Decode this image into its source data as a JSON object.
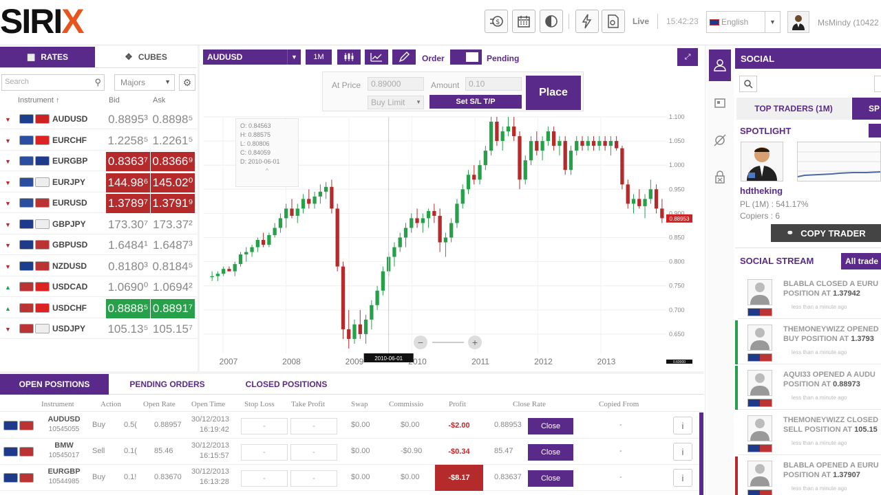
{
  "brand": {
    "logo_main": "SIRI",
    "logo_x": "X"
  },
  "topbar": {
    "live": "Live",
    "time": "15:42:23",
    "language": "English",
    "user": "MsMindy (10422"
  },
  "rates": {
    "tab_rates": "RATES",
    "tab_cubes": "CUBES",
    "search_placeholder": "Search",
    "filter": "Majors",
    "col_instrument": "Instrument ↑",
    "col_bid": "Bid",
    "col_ask": "Ask",
    "rows": [
      {
        "symbol": "AUDUSD",
        "bid": "0.8895³",
        "ask": "0.8898⁵",
        "dir": "down",
        "style": "plain",
        "flag1": "#1a3f8f",
        "flag2": "#c22"
      },
      {
        "symbol": "EURCHF",
        "bid": "1.2258⁵",
        "ask": "1.2261⁵",
        "dir": "down",
        "style": "plain",
        "flag1": "#2a4fa0",
        "flag2": "#d22"
      },
      {
        "symbol": "EURGBP",
        "bid": "0.8363⁷",
        "ask": "0.8366⁹",
        "dir": "down",
        "style": "red",
        "flag1": "#2a4fa0",
        "flag2": "#1d3b8a"
      },
      {
        "symbol": "EURJPY",
        "bid": "144.98⁶",
        "ask": "145.02⁰",
        "dir": "down",
        "style": "red",
        "flag1": "#2a4fa0",
        "flag2": "#eee"
      },
      {
        "symbol": "EURUSD",
        "bid": "1.3789⁷",
        "ask": "1.3791⁹",
        "dir": "down",
        "style": "red",
        "flag1": "#2a4fa0",
        "flag2": "#b33"
      },
      {
        "symbol": "GBPJPY",
        "bid": "173.30⁷",
        "ask": "173.37²",
        "dir": "down",
        "style": "plain",
        "flag1": "#1d3b8a",
        "flag2": "#eee"
      },
      {
        "symbol": "GBPUSD",
        "bid": "1.6484¹",
        "ask": "1.6487³",
        "dir": "down",
        "style": "plain",
        "flag1": "#1d3b8a",
        "flag2": "#b33"
      },
      {
        "symbol": "NZDUSD",
        "bid": "0.8180³",
        "ask": "0.8184⁵",
        "dir": "down",
        "style": "plain",
        "flag1": "#1a3f8f",
        "flag2": "#b33"
      },
      {
        "symbol": "USDCAD",
        "bid": "1.0690⁰",
        "ask": "1.0694²",
        "dir": "up",
        "style": "plain",
        "flag1": "#b33",
        "flag2": "#d22"
      },
      {
        "symbol": "USDCHF",
        "bid": "0.8888⁵",
        "ask": "0.8891⁷",
        "dir": "up",
        "style": "green",
        "flag1": "#b33",
        "flag2": "#d22"
      },
      {
        "symbol": "USDJPY",
        "bid": "105.13⁵",
        "ask": "105.15⁷",
        "dir": "down",
        "style": "plain",
        "flag1": "#b33",
        "flag2": "#eee"
      }
    ]
  },
  "chart_toolbar": {
    "symbol": "AUDUSD",
    "period": "1M",
    "order": "Order",
    "pending": "Pending"
  },
  "order_box": {
    "at_price_label": "At Price",
    "at_price": "0.89000",
    "amount_label": "Amount",
    "amount": "0.10",
    "order_type": "Buy Limit",
    "set_sltp": "Set S/L T/P",
    "place": "Place"
  },
  "ohlc": {
    "o": "O: 0.84563",
    "h": "H: 0.88575",
    "l": "L: 0.80806",
    "c": "C: 0.84059",
    "d": "D: 2010-06-01",
    "toggle": "^"
  },
  "chart_data": {
    "type": "candlestick",
    "symbol": "AUDUSD",
    "x_labels": [
      "2007",
      "2008",
      "2009",
      "2010",
      "2011",
      "2012",
      "2013"
    ],
    "y_ticks": [
      "1.100",
      "1.050",
      "1.000",
      "0.950",
      "0.900",
      "0.850",
      "0.800",
      "0.750",
      "0.700",
      "0.650"
    ],
    "ylim": [
      0.61,
      1.1
    ],
    "cursor_date": "2010-06-01",
    "last_price": "0.88953",
    "bottom_right_tag": "0.60000",
    "candles": [
      [
        0.77,
        0.78,
        0.76,
        0.77
      ],
      [
        0.77,
        0.78,
        0.76,
        0.775
      ],
      [
        0.775,
        0.79,
        0.77,
        0.785
      ],
      [
        0.785,
        0.79,
        0.78,
        0.78
      ],
      [
        0.78,
        0.8,
        0.77,
        0.795
      ],
      [
        0.795,
        0.82,
        0.79,
        0.815
      ],
      [
        0.815,
        0.83,
        0.8,
        0.82
      ],
      [
        0.82,
        0.835,
        0.81,
        0.83
      ],
      [
        0.83,
        0.85,
        0.82,
        0.845
      ],
      [
        0.845,
        0.86,
        0.83,
        0.835
      ],
      [
        0.835,
        0.86,
        0.83,
        0.855
      ],
      [
        0.855,
        0.88,
        0.85,
        0.87
      ],
      [
        0.87,
        0.9,
        0.86,
        0.89
      ],
      [
        0.89,
        0.92,
        0.87,
        0.91
      ],
      [
        0.91,
        0.93,
        0.89,
        0.895
      ],
      [
        0.895,
        0.92,
        0.88,
        0.91
      ],
      [
        0.91,
        0.94,
        0.9,
        0.93
      ],
      [
        0.93,
        0.95,
        0.91,
        0.92
      ],
      [
        0.92,
        0.945,
        0.91,
        0.935
      ],
      [
        0.935,
        0.96,
        0.92,
        0.945
      ],
      [
        0.945,
        0.965,
        0.93,
        0.955
      ],
      [
        0.955,
        0.97,
        0.9,
        0.91
      ],
      [
        0.91,
        0.92,
        0.78,
        0.79
      ],
      [
        0.79,
        0.8,
        0.64,
        0.66
      ],
      [
        0.66,
        0.7,
        0.62,
        0.64
      ],
      [
        0.64,
        0.68,
        0.63,
        0.67
      ],
      [
        0.67,
        0.7,
        0.64,
        0.65
      ],
      [
        0.65,
        0.69,
        0.63,
        0.68
      ],
      [
        0.68,
        0.72,
        0.66,
        0.71
      ],
      [
        0.71,
        0.75,
        0.7,
        0.74
      ],
      [
        0.74,
        0.79,
        0.73,
        0.78
      ],
      [
        0.78,
        0.82,
        0.77,
        0.81
      ],
      [
        0.81,
        0.84,
        0.79,
        0.83
      ],
      [
        0.83,
        0.86,
        0.82,
        0.85
      ],
      [
        0.85,
        0.88,
        0.83,
        0.87
      ],
      [
        0.87,
        0.9,
        0.86,
        0.89
      ],
      [
        0.89,
        0.91,
        0.87,
        0.88
      ],
      [
        0.88,
        0.9,
        0.86,
        0.89
      ],
      [
        0.89,
        0.91,
        0.87,
        0.905
      ],
      [
        0.905,
        0.92,
        0.88,
        0.895
      ],
      [
        0.895,
        0.91,
        0.82,
        0.84
      ],
      [
        0.84,
        0.86,
        0.81,
        0.85
      ],
      [
        0.85,
        0.89,
        0.84,
        0.88
      ],
      [
        0.88,
        0.93,
        0.87,
        0.92
      ],
      [
        0.92,
        0.96,
        0.91,
        0.95
      ],
      [
        0.95,
        0.99,
        0.94,
        0.98
      ],
      [
        0.98,
        1.0,
        0.96,
        0.97
      ],
      [
        0.97,
        1.01,
        0.96,
        1.0
      ],
      [
        1.0,
        1.04,
        0.99,
        1.03
      ],
      [
        1.03,
        1.1,
        1.02,
        1.09
      ],
      [
        1.09,
        1.1,
        1.04,
        1.05
      ],
      [
        1.05,
        1.08,
        1.03,
        1.07
      ],
      [
        1.07,
        1.1,
        1.06,
        1.08
      ],
      [
        1.08,
        1.1,
        1.05,
        1.06
      ],
      [
        1.06,
        1.07,
        0.95,
        0.97
      ],
      [
        0.97,
        1.02,
        0.96,
        1.01
      ],
      [
        1.01,
        1.06,
        1.0,
        1.05
      ],
      [
        1.05,
        1.07,
        1.02,
        1.03
      ],
      [
        1.03,
        1.06,
        1.01,
        1.05
      ],
      [
        1.05,
        1.08,
        1.04,
        1.07
      ],
      [
        1.07,
        1.08,
        1.03,
        1.04
      ],
      [
        1.04,
        1.06,
        1.02,
        1.05
      ],
      [
        1.05,
        1.06,
        0.98,
        0.99
      ],
      [
        0.99,
        1.04,
        0.98,
        1.03
      ],
      [
        1.03,
        1.06,
        1.02,
        1.05
      ],
      [
        1.05,
        1.06,
        1.03,
        1.04
      ],
      [
        1.04,
        1.06,
        1.03,
        1.05
      ],
      [
        1.05,
        1.06,
        1.03,
        1.04
      ],
      [
        1.04,
        1.06,
        1.03,
        1.05
      ],
      [
        1.05,
        1.06,
        1.03,
        1.04
      ],
      [
        1.04,
        1.06,
        1.02,
        1.05
      ],
      [
        1.05,
        1.06,
        1.03,
        1.035
      ],
      [
        1.035,
        1.04,
        0.95,
        0.96
      ],
      [
        0.96,
        0.97,
        0.91,
        0.92
      ],
      [
        0.92,
        0.94,
        0.9,
        0.93
      ],
      [
        0.93,
        0.95,
        0.91,
        0.915
      ],
      [
        0.915,
        0.94,
        0.89,
        0.93
      ],
      [
        0.93,
        0.97,
        0.92,
        0.95
      ],
      [
        0.95,
        0.96,
        0.9,
        0.91
      ],
      [
        0.91,
        0.93,
        0.88,
        0.89
      ]
    ]
  },
  "positions": {
    "tab_open": "OPEN POSITIONS",
    "tab_pending": "PENDING ORDERS",
    "tab_closed": "CLOSED POSITIONS",
    "headers": {
      "instrument": "Instrument",
      "action": "Action",
      "open_rate": "Open Rate",
      "open_time": "Open Time",
      "stop_loss": "Stop Loss",
      "take_profit": "Take Profit",
      "swap": "Swap",
      "commission": "Commissio",
      "profit": "Profit",
      "close_rate": "Close Rate",
      "copied_from": "Copied From"
    },
    "rows": [
      {
        "symbol": "AUDUSD",
        "id": "10545055",
        "action": "Buy",
        "amount": "0.5(",
        "open_rate": "0.88957",
        "date": "30/12/2013",
        "time": "16:19:42",
        "sl": "-",
        "tp": "-",
        "swap": "$0.00",
        "commission": "$0.00",
        "profit": "-$2.00",
        "profit_bg": "none",
        "close_rate": "0.88953",
        "close": "Close",
        "copied": "-"
      },
      {
        "symbol": "BMW",
        "id": "10545017",
        "action": "Sell",
        "amount": "0.1(",
        "open_rate": "85.46",
        "date": "30/12/2013",
        "time": "16:15:57",
        "sl": "-",
        "tp": "-",
        "swap": "$0.00",
        "commission": "-$0.90",
        "profit": "-$0.34",
        "profit_bg": "none",
        "close_rate": "85.47",
        "close": "Close",
        "copied": "-"
      },
      {
        "symbol": "EURGBP",
        "id": "10544985",
        "action": "Buy",
        "amount": "0.1!",
        "open_rate": "0.83670",
        "date": "30/12/2013",
        "time": "16:13:28",
        "sl": "-",
        "tp": "-",
        "swap": "$0.00",
        "commission": "$0.00",
        "profit": "-$8.17",
        "profit_bg": "red",
        "close_rate": "0.83637",
        "close": "Close",
        "copied": "-"
      }
    ]
  },
  "social": {
    "title": "SOCIAL",
    "tab_top": "TOP TRADERS (1M)",
    "tab_sp": "SP",
    "spotlight": "SPOTLIGHT",
    "trader_name": "hdtheking",
    "trader_pl": "PL (1M) : 541.17%",
    "trader_copiers": "Copiers : 6",
    "copy_trader": "COPY TRADER",
    "stream_title": "SOCIAL STREAM",
    "all_trades": "All trade",
    "stream": [
      {
        "line1": "BLABLA CLOSED A EURU",
        "line2": "POSITION AT ",
        "val": "1.37942",
        "time": "less than a minute ago",
        "bar": "#fff"
      },
      {
        "line1": "THEMONEYWIZZ OPENED",
        "line2": "BUY POSITION AT ",
        "val": "1.3793",
        "time": "less than a minute ago",
        "bar": "#27a04a"
      },
      {
        "line1": "AQUI33 OPENED A AUDU",
        "line2": "POSITION AT ",
        "val": "0.88973",
        "time": "less than a minute ago",
        "bar": "#27a04a"
      },
      {
        "line1": "THEMONEYWIZZ CLOSED",
        "line2": "SELL POSITION AT ",
        "val": "105.15",
        "time": "less than a minute ago",
        "bar": "#fff"
      },
      {
        "line1": "BLABLA OPENED A EURU",
        "line2": "POSITION AT ",
        "val": "1.37907",
        "time": "less than a minute ago",
        "bar": "#b52a2a"
      }
    ]
  }
}
